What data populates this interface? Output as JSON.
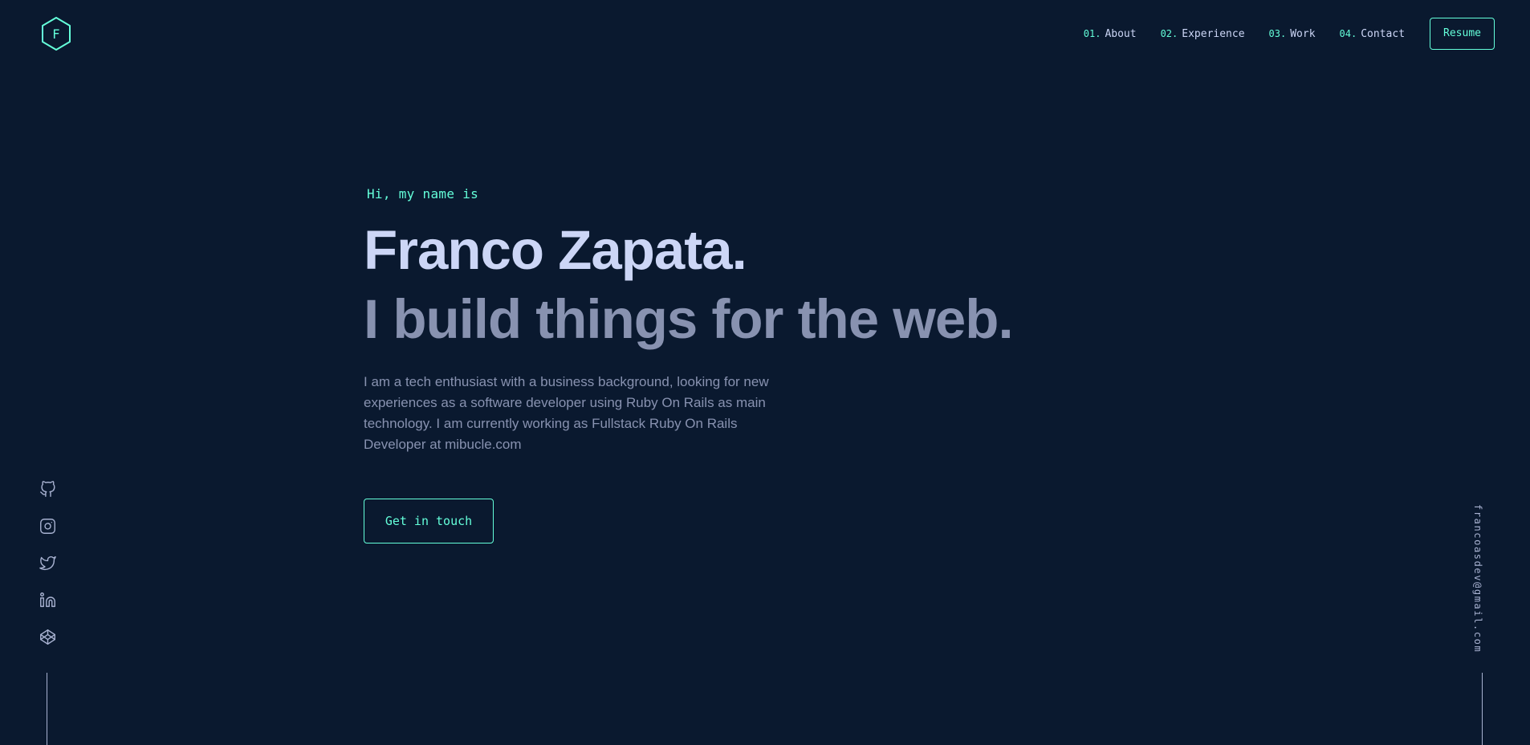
{
  "header": {
    "logo_letter": "F",
    "nav": [
      {
        "num": "01.",
        "label": "About"
      },
      {
        "num": "02.",
        "label": "Experience"
      },
      {
        "num": "03.",
        "label": "Work"
      },
      {
        "num": "04.",
        "label": "Contact"
      }
    ],
    "resume_label": "Resume"
  },
  "hero": {
    "greeting": "Hi, my name is",
    "name": "Franco Zapata.",
    "tagline": "I build things for the web.",
    "intro": "I am a tech enthusiast with a business background, looking for new experiences as a software developer using Ruby On Rails as main technology. I am currently working as Fullstack Ruby On Rails Developer at mibucle.com",
    "cta_label": "Get in touch"
  },
  "social": {
    "icons": [
      "github-icon",
      "instagram-icon",
      "twitter-icon",
      "linkedin-icon",
      "codepen-icon"
    ]
  },
  "email": "francoasdev@gmail.com",
  "colors": {
    "background": "#0a192f",
    "accent": "#64ffda",
    "heading": "#ccd6f6",
    "text": "#8892b0",
    "light": "#a8b2d1"
  }
}
